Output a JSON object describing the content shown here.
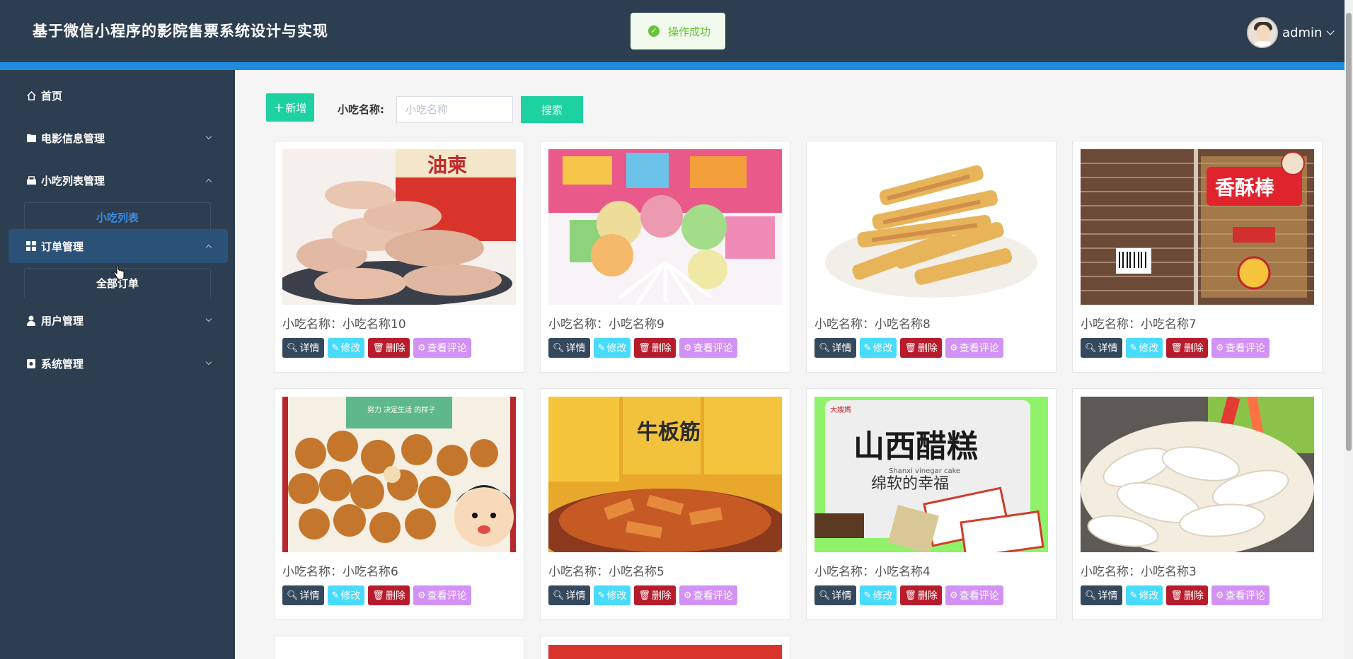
{
  "header": {
    "title": "基于微信小程序的影院售票系统设计与实现",
    "toast": "操作成功",
    "user": "admin"
  },
  "sidebar": {
    "items": [
      {
        "label": "首页",
        "icon": "home-icon"
      },
      {
        "label": "电影信息管理",
        "icon": "film-icon"
      },
      {
        "label": "小吃列表管理",
        "icon": "snack-icon"
      },
      {
        "label": "订单管理",
        "icon": "grid-icon"
      },
      {
        "label": "用户管理",
        "icon": "user-icon"
      },
      {
        "label": "系统管理",
        "icon": "settings-icon"
      }
    ],
    "sub_snack": "小吃列表",
    "sub_order": "全部订单"
  },
  "toolbar": {
    "add_label": "新增",
    "search_label": "小吃名称:",
    "search_placeholder": "小吃名称",
    "search_button": "搜索"
  },
  "card_actions": {
    "detail": "详情",
    "edit": "修改",
    "delete": "删除",
    "review": "查看评论"
  },
  "cards": [
    {
      "name": "小吃名称：小吃名称10"
    },
    {
      "name": "小吃名称：小吃名称9"
    },
    {
      "name": "小吃名称：小吃名称8"
    },
    {
      "name": "小吃名称：小吃名称7"
    },
    {
      "name": "小吃名称：小吃名称6"
    },
    {
      "name": "小吃名称：小吃名称5"
    },
    {
      "name": "小吃名称：小吃名称4"
    },
    {
      "name": "小吃名称：小吃名称3"
    }
  ],
  "image_text": {
    "card1": "油柬",
    "card4": "香酥棒",
    "card5": "努力 决定生活 的样子",
    "card6": "牛板筋",
    "card7_brand": "大嫂媽",
    "card7_title": "山西醋糕",
    "card7_sub": "Shanxi vinegar cake",
    "card7_sub2": "绵软的幸福"
  },
  "colors": {
    "header": "#2c3e50",
    "accent_bar": "#1e8de0",
    "add": "#1dd1a1",
    "detail": "#34495e",
    "edit": "#48dbfb",
    "delete": "#b71c2c",
    "review": "#d291f5"
  }
}
